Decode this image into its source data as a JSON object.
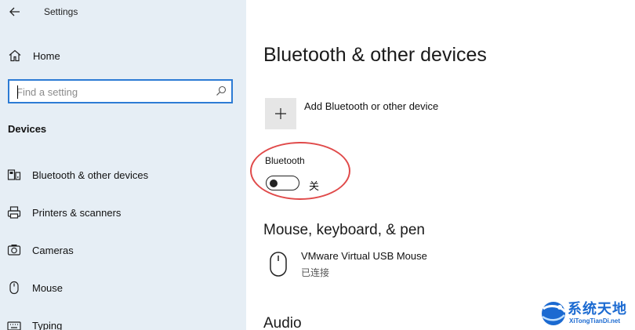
{
  "app": {
    "title": "Settings"
  },
  "sidebar": {
    "home_label": "Home",
    "search": {
      "placeholder": "Find a setting",
      "value": ""
    },
    "section_label": "Devices",
    "items": [
      {
        "label": "Bluetooth & other devices",
        "icon": "bluetooth-devices-icon"
      },
      {
        "label": "Printers & scanners",
        "icon": "printer-icon"
      },
      {
        "label": "Cameras",
        "icon": "camera-icon"
      },
      {
        "label": "Mouse",
        "icon": "mouse-icon"
      },
      {
        "label": "Typing",
        "icon": "keyboard-icon"
      }
    ]
  },
  "main": {
    "title": "Bluetooth & other devices",
    "add_device_label": "Add Bluetooth or other device",
    "bluetooth": {
      "label": "Bluetooth",
      "state_label": "关",
      "on": false
    },
    "sections": {
      "mouse_keyboard_pen": "Mouse, keyboard, & pen",
      "audio": "Audio"
    },
    "devices": [
      {
        "name": "VMware Virtual USB Mouse",
        "status": "已连接",
        "icon": "mouse-icon"
      }
    ]
  },
  "watermark": {
    "title": "系统天地",
    "url": "XiTongTianDi.net"
  },
  "colors": {
    "sidebar_bg": "#e6eef5",
    "accent": "#2c7bd4",
    "annotation_red": "#e04a4a",
    "watermark_blue": "#1b6ad1"
  }
}
